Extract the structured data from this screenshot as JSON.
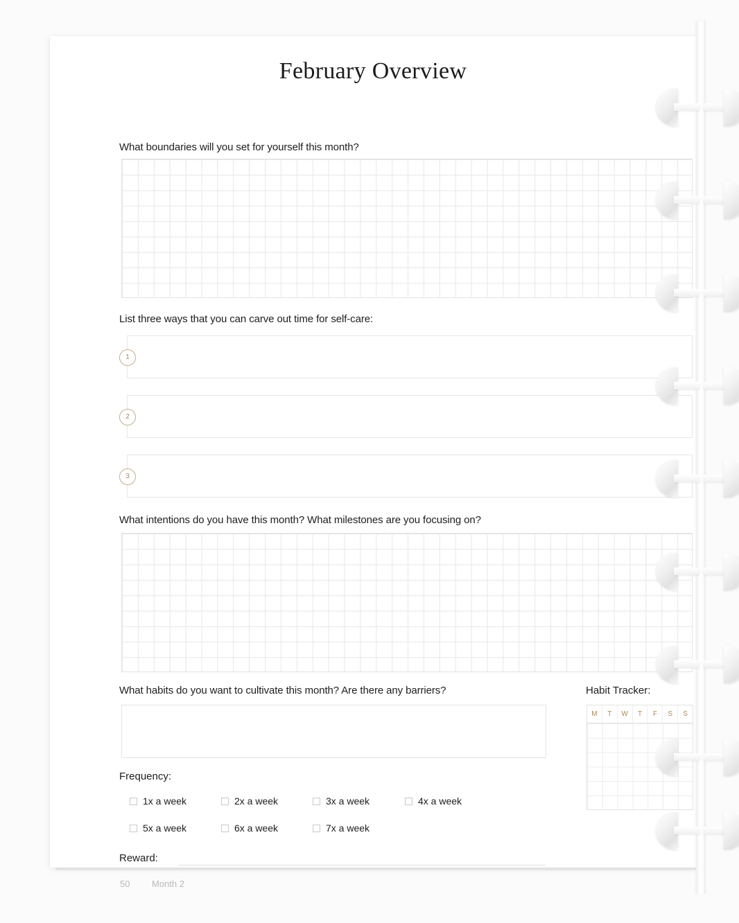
{
  "page": {
    "title": "February Overview",
    "footer_page_number": "50",
    "footer_section": "Month 2",
    "accent_gold": "#a78a5c",
    "accent_circle_border": "#c3ae92",
    "grid_line_color": "#e7e7e7",
    "paper_color": "#ffffff",
    "background_color": "#fbfbfb"
  },
  "prompts": {
    "boundaries": "What boundaries will you set for yourself this month?",
    "self_care": "List three ways that you can carve out time for self-care:",
    "intentions": "What intentions do you have this month? What milestones are you focusing on?",
    "habits": "What habits do you want to cultivate this month? Are there any barriers?"
  },
  "self_care_items": [
    {
      "number": "1",
      "value": ""
    },
    {
      "number": "2",
      "value": ""
    },
    {
      "number": "3",
      "value": ""
    }
  ],
  "habit_tracker": {
    "title": "Habit Tracker:",
    "day_headers": [
      "M",
      "T",
      "W",
      "T",
      "F",
      "S",
      "S"
    ],
    "rows": 6
  },
  "frequency": {
    "label": "Frequency:",
    "options": [
      {
        "label": "1x a week",
        "checked": false
      },
      {
        "label": "2x a week",
        "checked": false
      },
      {
        "label": "3x a week",
        "checked": false
      },
      {
        "label": "4x a week",
        "checked": false
      },
      {
        "label": "5x a week",
        "checked": false
      },
      {
        "label": "6x a week",
        "checked": false
      },
      {
        "label": "7x a week",
        "checked": false
      }
    ]
  },
  "reward": {
    "label": "Reward:",
    "value": ""
  },
  "binding": {
    "type": "discbound-rings",
    "disc_count": 8
  }
}
